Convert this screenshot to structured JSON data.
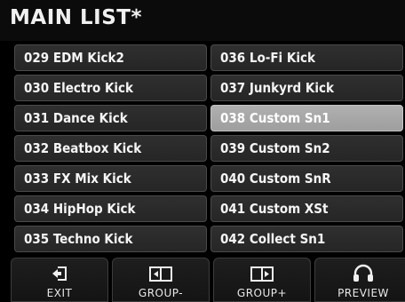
{
  "header": {
    "title": "MAIN LIST*"
  },
  "list": {
    "left_column": [
      {
        "label": "029  EDM Kick2"
      },
      {
        "label": "030  Electro Kick"
      },
      {
        "label": "031  Dance Kick"
      },
      {
        "label": "032  Beatbox Kick"
      },
      {
        "label": "033  FX Mix Kick"
      },
      {
        "label": "034  HipHop  Kick"
      },
      {
        "label": "035  Techno Kick"
      }
    ],
    "right_column": [
      {
        "label": "036  Lo-Fi Kick"
      },
      {
        "label": "037  Junkyrd Kick"
      },
      {
        "label": "038  Custom Sn1",
        "selected": true
      },
      {
        "label": "039  Custom Sn2"
      },
      {
        "label": "040  Custom SnR"
      },
      {
        "label": "041  Custom XSt"
      },
      {
        "label": "042  Collect Sn1"
      }
    ]
  },
  "footer": {
    "buttons": [
      {
        "label": "EXIT",
        "icon": "exit-icon"
      },
      {
        "label": "GROUP-",
        "icon": "group-minus-icon"
      },
      {
        "label": "GROUP+",
        "icon": "group-plus-icon"
      },
      {
        "label": "PREVIEW",
        "icon": "headphones-icon"
      }
    ]
  },
  "colors": {
    "background": "#000000",
    "cell": "#2b2b2b",
    "selected_cell": "#a8a8a8",
    "text": "#f5f5f5"
  }
}
